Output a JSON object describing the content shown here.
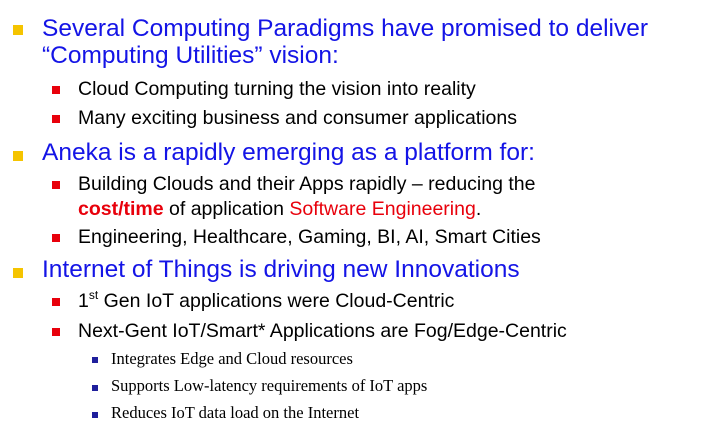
{
  "colors": {
    "level1_text": "#1414e6",
    "level1_bullet": "#f5c400",
    "level2_bullet": "#e8000b",
    "level3_bullet": "#1f1f9c",
    "highlight": "#e8000b"
  },
  "section1": {
    "line1": "Several Computing Paradigms have promised to deliver",
    "line2": "“Computing Utilities” vision:",
    "items": [
      "Cloud Computing turning the vision into reality",
      "Many exciting business and consumer applications"
    ]
  },
  "section2": {
    "title": "Aneka is a rapidly emerging as a platform for:",
    "item1_line1": "Building Clouds and their Apps rapidly – reducing the",
    "item1_bold": "cost/time",
    "item1_mid": " of application ",
    "item1_red": "Software Engineering",
    "item1_end": ".",
    "item2": "Engineering, Healthcare, Gaming, BI, AI, Smart Cities"
  },
  "section3": {
    "title": "Internet of Things is driving new Innovations",
    "item1_pre": "1",
    "item1_sup": "st",
    "item1_post": " Gen IoT applications were Cloud-Centric",
    "item2": "Next-Gent IoT/Smart* Applications are Fog/Edge-Centric",
    "subitems": [
      "Integrates Edge and Cloud resources",
      "Supports Low-latency requirements of IoT apps",
      "Reduces IoT data load on the Internet"
    ]
  }
}
